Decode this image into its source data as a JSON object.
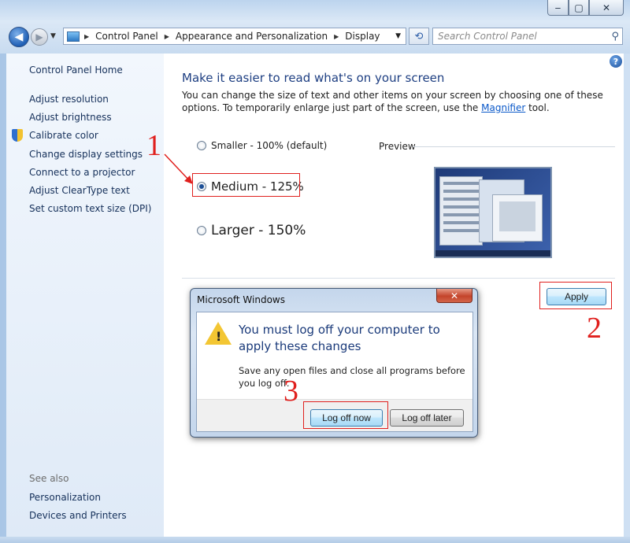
{
  "window": {
    "controls": {
      "minimize": "‒",
      "maximize": "▢",
      "close": "✕"
    }
  },
  "navigation": {
    "back_icon": "back-arrow-icon",
    "forward_icon": "forward-arrow-icon"
  },
  "address": {
    "breadcrumb": [
      "Control Panel",
      "Appearance and Personalization",
      "Display"
    ],
    "search_placeholder": "Search Control Panel"
  },
  "sidebar": {
    "home": "Control Panel Home",
    "items": [
      {
        "label": "Adjust resolution"
      },
      {
        "label": "Adjust brightness"
      },
      {
        "label": "Calibrate color",
        "icon": "uac-shield-icon"
      },
      {
        "label": "Change display settings"
      },
      {
        "label": "Connect to a projector"
      },
      {
        "label": "Adjust ClearType text"
      },
      {
        "label": "Set custom text size (DPI)"
      }
    ],
    "see_also": "See also",
    "see_also_items": [
      "Personalization",
      "Devices and Printers"
    ]
  },
  "main": {
    "help": "?",
    "heading": "Make it easier to read what's on your screen",
    "description_before": "You can change the size of text and other items on your screen by choosing one of these options. To temporarily enlarge just part of the screen, use the ",
    "description_link": "Magnifier",
    "description_after": " tool.",
    "options": [
      {
        "label": "Smaller - 100% (default)",
        "selected": false
      },
      {
        "label": "Medium - 125%",
        "selected": true
      },
      {
        "label": "Larger - 150%",
        "selected": false
      }
    ],
    "preview_label": "Preview",
    "apply_label": "Apply"
  },
  "dialog": {
    "title": "Microsoft Windows",
    "close": "✕",
    "heading": "You must log off your computer to apply these changes",
    "message": "Save any open files and close all programs before you log off.",
    "buttons": {
      "log_off_now": "Log off now",
      "log_off_later": "Log off later"
    }
  },
  "annotations": {
    "step1": "1",
    "step2": "2",
    "step3": "3",
    "color": "#e0201e"
  }
}
